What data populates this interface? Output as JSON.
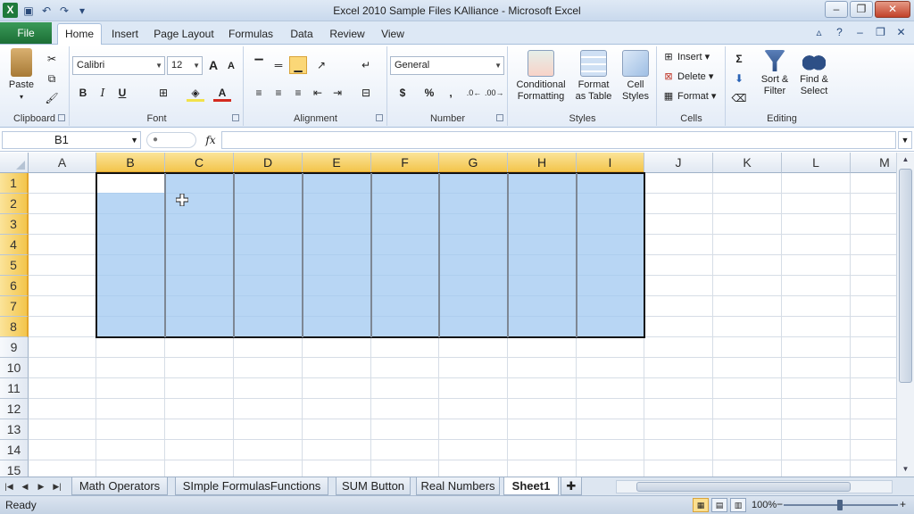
{
  "window": {
    "title": "Excel 2010 Sample Files KAlliance  -  Microsoft Excel",
    "app_icon": "excel-icon",
    "quick_access": [
      "save-icon",
      "undo-icon",
      "redo-icon",
      "customize-icon"
    ],
    "controls": {
      "minimize": "–",
      "restore": "❐",
      "close": "✕"
    }
  },
  "ribbon_tabs": {
    "file": "File",
    "tabs": [
      "Home",
      "Insert",
      "Page Layout",
      "Formulas",
      "Data",
      "Review",
      "View"
    ],
    "active": "Home"
  },
  "ribbon": {
    "clipboard": {
      "label": "Clipboard",
      "paste": "Paste"
    },
    "font": {
      "label": "Font",
      "font_name": "Calibri",
      "font_size": "12",
      "bold": "B",
      "italic": "I",
      "underline": "U",
      "grow": "A",
      "shrink": "A"
    },
    "alignment": {
      "label": "Alignment"
    },
    "number": {
      "label": "Number",
      "format": "General",
      "currency": "$",
      "percent": "%",
      "comma": ","
    },
    "styles": {
      "label": "Styles",
      "conditional": "Conditional",
      "conditional2": "Formatting",
      "format_table": "Format",
      "format_table2": "as Table",
      "cell_styles": "Cell",
      "cell_styles2": "Styles"
    },
    "cells": {
      "label": "Cells",
      "insert": "Insert",
      "delete": "Delete",
      "format": "Format"
    },
    "editing": {
      "label": "Editing",
      "sort": "Sort &",
      "sort2": "Filter",
      "find": "Find &",
      "find2": "Select"
    }
  },
  "formula_bar": {
    "name_box": "B1",
    "fx": "fx",
    "value": ""
  },
  "grid": {
    "columns": [
      "A",
      "B",
      "C",
      "D",
      "E",
      "F",
      "G",
      "H",
      "I",
      "J",
      "K",
      "L",
      "M"
    ],
    "rows": [
      "1",
      "2",
      "3",
      "4",
      "5",
      "6",
      "7",
      "8",
      "9",
      "10",
      "11",
      "12",
      "13",
      "14",
      "15"
    ],
    "selected_range": "B1:I8",
    "active_cell": "B1"
  },
  "sheets": {
    "tabs": [
      "Math Operators",
      "SImple FormulasFunctions",
      "SUM Button",
      "Real Numbers",
      "Sheet1"
    ],
    "active": "Sheet1"
  },
  "status": {
    "ready": "Ready",
    "zoom": "100%"
  },
  "colors": {
    "selection": "#a0c8f0",
    "header_selected": "#f3c54c",
    "file_tab": "#1f7a3c"
  }
}
